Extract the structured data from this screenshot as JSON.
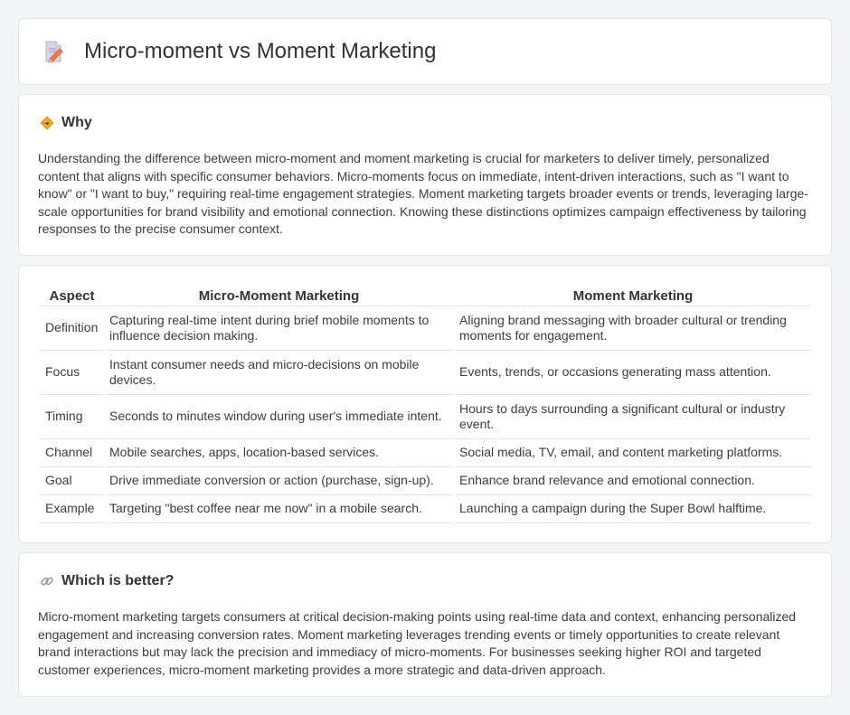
{
  "header": {
    "title": "Micro-moment vs Moment Marketing",
    "icon": "document-pencil-icon"
  },
  "why": {
    "title": "Why",
    "icon": "diamond-sign-icon",
    "body": "Understanding the difference between micro-moment and moment marketing is crucial for marketers to deliver timely, personalized content that aligns with specific consumer behaviors. Micro-moments focus on immediate, intent-driven interactions, such as \"I want to know\" or \"I want to buy,\" requiring real-time engagement strategies. Moment marketing targets broader events or trends, leveraging large-scale opportunities for brand visibility and emotional connection. Knowing these distinctions optimizes campaign effectiveness by tailoring responses to the precise consumer context."
  },
  "table": {
    "headers": [
      "Aspect",
      "Micro-Moment Marketing",
      "Moment Marketing"
    ],
    "rows": [
      [
        "Definition",
        "Capturing real-time intent during brief mobile moments to influence decision making.",
        "Aligning brand messaging with broader cultural or trending moments for engagement."
      ],
      [
        "Focus",
        "Instant consumer needs and micro-decisions on mobile devices.",
        "Events, trends, or occasions generating mass attention."
      ],
      [
        "Timing",
        "Seconds to minutes window during user's immediate intent.",
        "Hours to days surrounding a significant cultural or industry event."
      ],
      [
        "Channel",
        "Mobile searches, apps, location-based services.",
        "Social media, TV, email, and content marketing platforms."
      ],
      [
        "Goal",
        "Drive immediate conversion or action (purchase, sign-up).",
        "Enhance brand relevance and emotional connection."
      ],
      [
        "Example",
        "Targeting \"best coffee near me now\" in a mobile search.",
        "Launching a campaign during the Super Bowl halftime."
      ]
    ]
  },
  "better": {
    "title": "Which is better?",
    "icon": "link-icon",
    "body": "Micro-moment marketing targets consumers at critical decision-making points using real-time data and context, enhancing personalized engagement and increasing conversion rates. Moment marketing leverages trending events or timely opportunities to create relevant brand interactions but may lack the precision and immediacy of micro-moments. For businesses seeking higher ROI and targeted customer experiences, micro-moment marketing provides a more strategic and data-driven approach."
  },
  "colors": {
    "background": "#f4f5f7",
    "card": "#ffffff",
    "border": "#e2e4e8",
    "accent_orange": "#f5a623"
  }
}
